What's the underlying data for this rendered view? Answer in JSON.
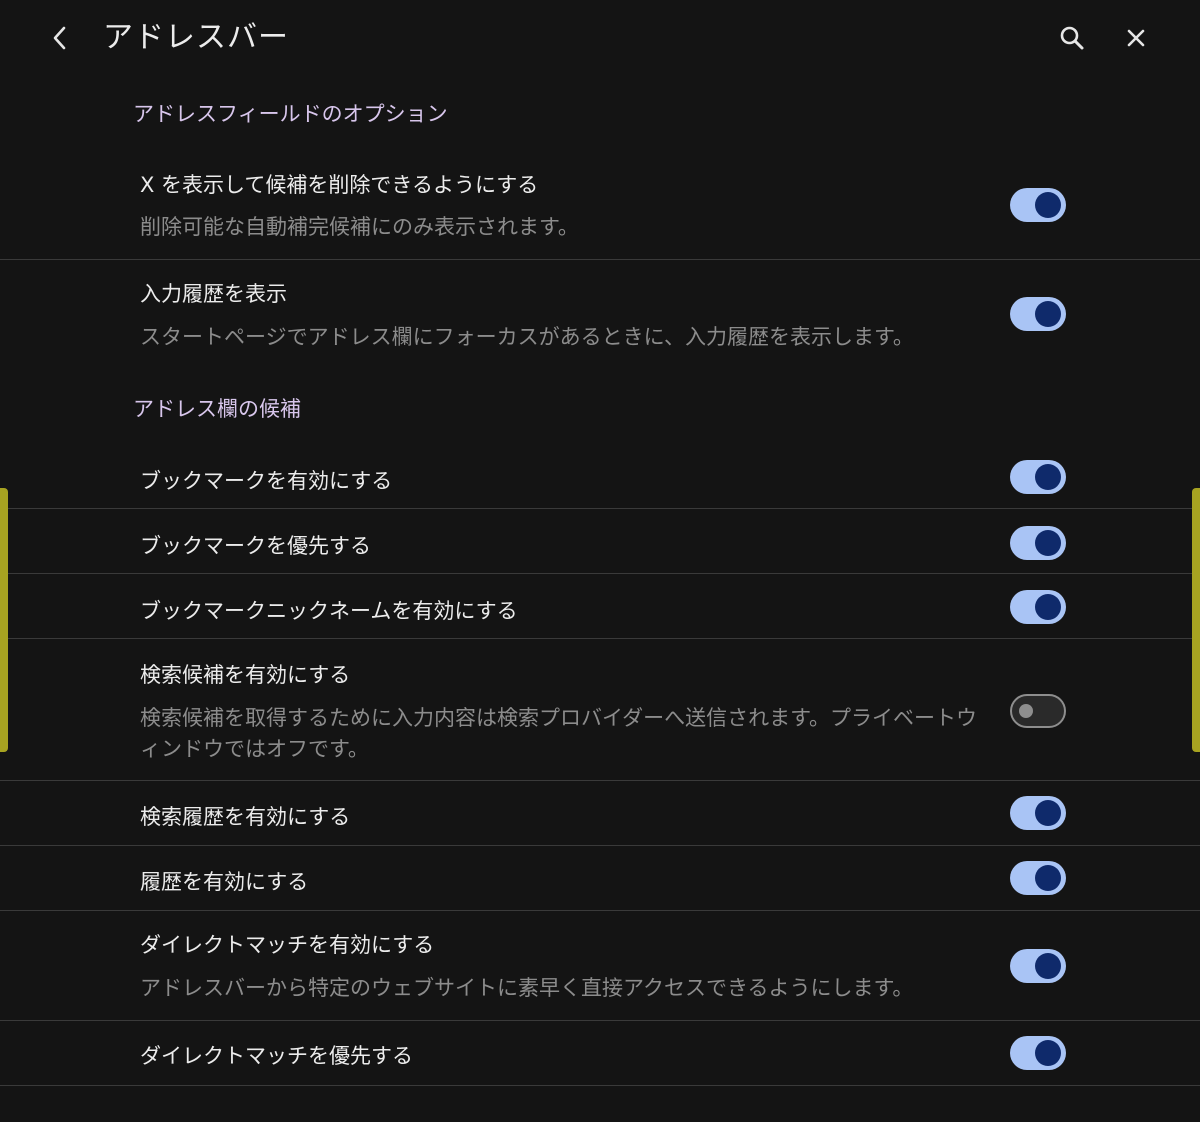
{
  "header": {
    "title": "アドレスバー",
    "back_icon": "chevron-left-icon",
    "search_icon": "search-icon",
    "close_icon": "close-icon"
  },
  "sections": [
    {
      "title": "アドレスフィールドのオプション",
      "items": [
        {
          "title": "X を表示して候補を削除できるようにする",
          "desc": "削除可能な自動補完候補にのみ表示されます。",
          "enabled": true
        },
        {
          "title": "入力履歴を表示",
          "desc": "スタートページでアドレス欄にフォーカスがあるときに、入力履歴を表示します。",
          "enabled": true
        }
      ]
    },
    {
      "title": "アドレス欄の候補",
      "items": [
        {
          "title": "ブックマークを有効にする",
          "enabled": true
        },
        {
          "title": "ブックマークを優先する",
          "enabled": true
        },
        {
          "title": "ブックマークニックネームを有効にする",
          "enabled": true
        },
        {
          "title": "検索候補を有効にする",
          "desc": "検索候補を取得するために入力内容は検索プロバイダーへ送信されます。プライベートウィンドウではオフです。",
          "enabled": false
        },
        {
          "title": "検索履歴を有効にする",
          "enabled": true
        },
        {
          "title": "履歴を有効にする",
          "enabled": true
        },
        {
          "title": "ダイレクトマッチを有効にする",
          "desc": "アドレスバーから特定のウェブサイトに素早く直接アクセスできるようにします。",
          "enabled": true
        },
        {
          "title": "ダイレクトマッチを優先する",
          "enabled": true
        }
      ]
    }
  ],
  "colors": {
    "background": "#141414",
    "section_header": "#d8c6ec",
    "toggle_on_track": "#a9c4f5",
    "toggle_on_knob": "#0f2a6b",
    "edge_indicator": "#a7a321"
  }
}
